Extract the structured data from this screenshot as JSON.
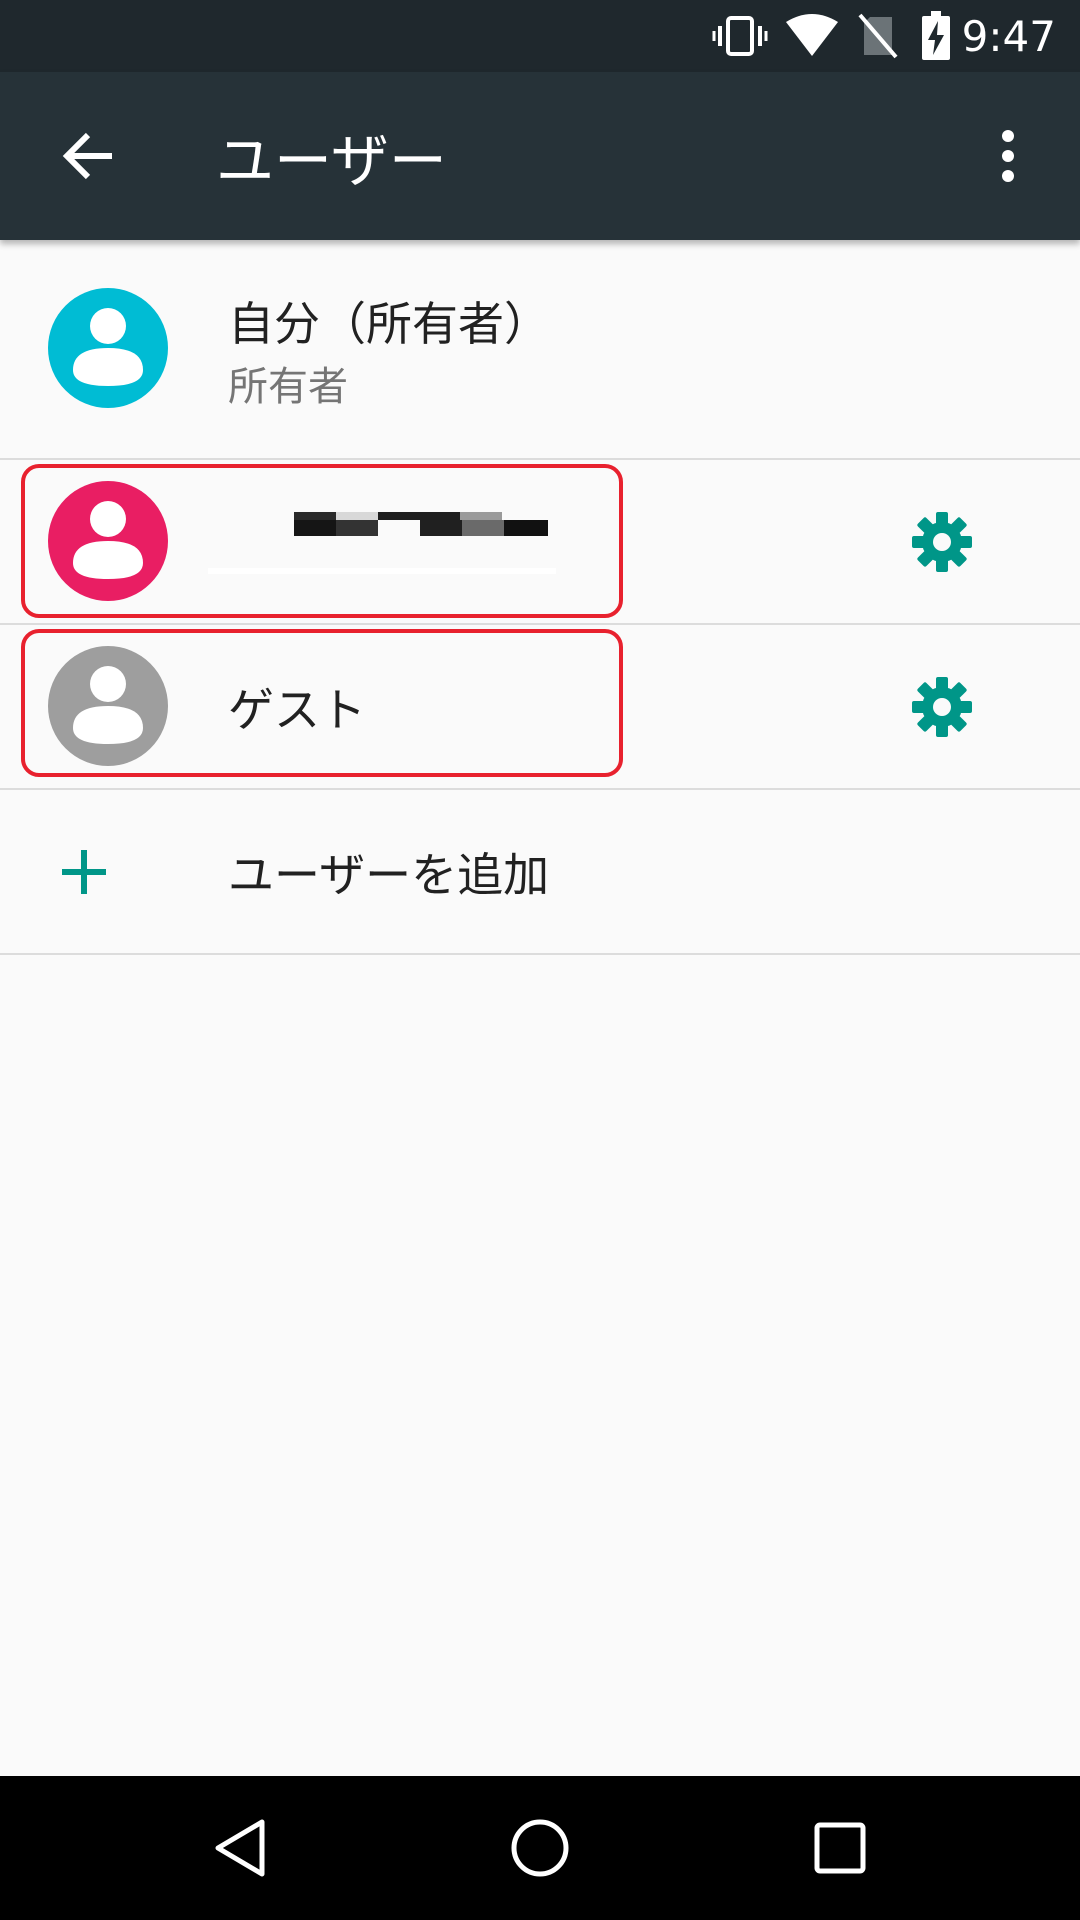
{
  "status_bar": {
    "time": "9:47",
    "icons": [
      "vibrate-icon",
      "wifi-icon",
      "no-sim-icon",
      "battery-charging-icon"
    ]
  },
  "app_bar": {
    "title": "ユーザー",
    "back_icon": "arrow-back-icon",
    "menu_icon": "more-vert-icon"
  },
  "users": {
    "owner": {
      "name": "自分（所有者）",
      "role": "所有者",
      "avatar_color": "#00bcd4"
    },
    "secondary_user": {
      "name_redacted": true,
      "avatar_color": "#e91e63",
      "settings_icon": "gear-icon"
    },
    "guest": {
      "name": "ゲスト",
      "avatar_color": "#9e9e9e",
      "settings_icon": "gear-icon"
    },
    "add_user": {
      "label": "ユーザーを追加",
      "icon": "plus-icon"
    }
  },
  "colors": {
    "accent": "#009688",
    "highlight": "#e8212e",
    "app_bar": "#263238",
    "status_bar": "#1f282d"
  },
  "nav_bar": {
    "icons": [
      "back-triangle-icon",
      "home-circle-icon",
      "recents-square-icon"
    ]
  }
}
